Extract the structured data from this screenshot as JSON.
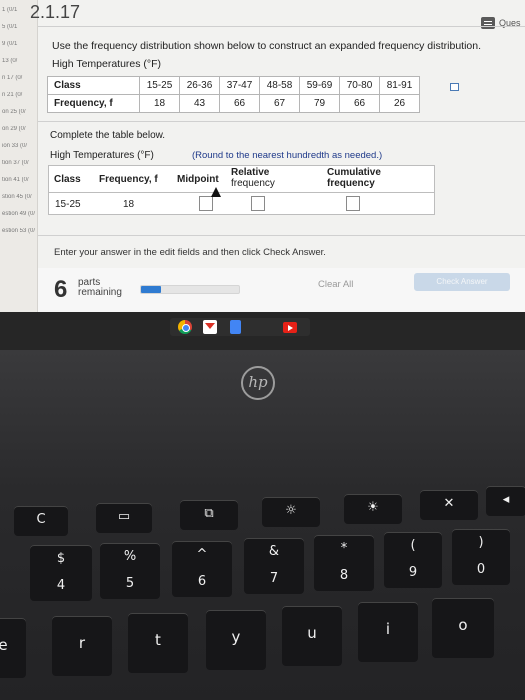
{
  "problem": {
    "number": "2.1.17",
    "question_button": "Ques",
    "instructions": "Use the frequency distribution shown below to construct an expanded frequency distribution.",
    "freq_title": "High Temperatures (°F)"
  },
  "left_rail": [
    "1 (0/1",
    "5 (0/1",
    "9 (0/1",
    "13 (0/",
    "n 17 (0/",
    "n 21 (0/",
    "on 25 (0/",
    "on 29 (0/",
    "ion 33 (0/",
    "tion 37 (0/",
    "tion 41 (0/",
    "stion 45 (0/",
    "estion 49 (0/",
    "estion 53 (0/"
  ],
  "frequency_table": {
    "class_label": "Class",
    "freq_label": "Frequency, f",
    "classes": [
      "15-25",
      "26-36",
      "37-47",
      "48-58",
      "59-69",
      "70-80",
      "81-91"
    ],
    "frequencies": [
      "18",
      "43",
      "66",
      "67",
      "79",
      "66",
      "26"
    ]
  },
  "complete": {
    "title": "Complete the table below.",
    "subtitle": "High Temperatures (°F)",
    "round_note": "(Round to the nearest hundredth as needed.)",
    "headers": {
      "class": "Class",
      "frequency": "Frequency, f",
      "midpoint": "Midpoint",
      "relative_line1": "Relative",
      "relative_line2": "frequency",
      "cumulative_line1": "Cumulative",
      "cumulative_line2": "frequency"
    },
    "row": {
      "class": "15-25",
      "frequency": "18"
    }
  },
  "footer": {
    "enter_note": "Enter your answer in the edit fields and then click Check Answer.",
    "parts_count": "6",
    "parts_label1": "parts",
    "parts_label2": "remaining",
    "progress": 0.2,
    "clear_all": "Clear All",
    "check_answer": "Check Answer"
  },
  "brand": {
    "logo_text": "hp"
  },
  "keyboard": {
    "fn_row": [
      "C",
      "",
      "",
      "",
      "",
      ""
    ],
    "num_row": [
      {
        "top": "$",
        "bot": "4"
      },
      {
        "top": "%",
        "bot": "5"
      },
      {
        "top": "^",
        "bot": "6"
      },
      {
        "top": "&",
        "bot": "7"
      },
      {
        "top": "*",
        "bot": "8"
      },
      {
        "top": "(",
        "bot": "9"
      },
      {
        "top": ")",
        "bot": "0"
      }
    ],
    "letter_row": [
      "e",
      "r",
      "t",
      "y",
      "u",
      "i",
      "o"
    ]
  },
  "colors": {
    "accent": "#2f7bd1",
    "note_blue": "#1f3a8a"
  }
}
